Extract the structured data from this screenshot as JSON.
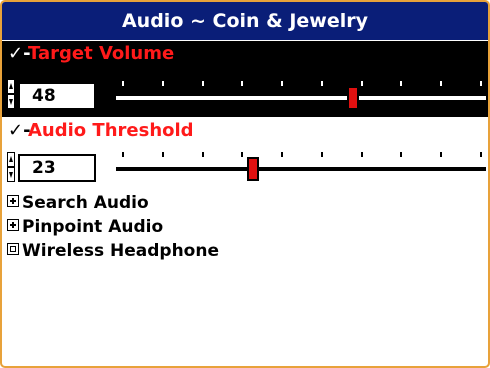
{
  "header": {
    "title": "Audio ~ Coin & Jewelry"
  },
  "settings": [
    {
      "check": "✓-",
      "label": "Target Volume",
      "value": "48",
      "level_percent": 64,
      "selected": true
    },
    {
      "check": "✓-",
      "label": "Audio Threshold",
      "value": "23",
      "level_percent": 37,
      "selected": false
    }
  ],
  "menu": [
    {
      "label": "Search Audio",
      "expander": "plus"
    },
    {
      "label": "Pinpoint Audio",
      "expander": "plus"
    },
    {
      "label": "Wireless Headphone",
      "expander": "square"
    }
  ],
  "colors": {
    "title_bar": "#0a1e78",
    "label_red": "#ff1a1a",
    "selected_bg": "#000000",
    "frame_border": "#e8a23a",
    "thumb": "#e01010"
  },
  "slider_ticks": 10
}
